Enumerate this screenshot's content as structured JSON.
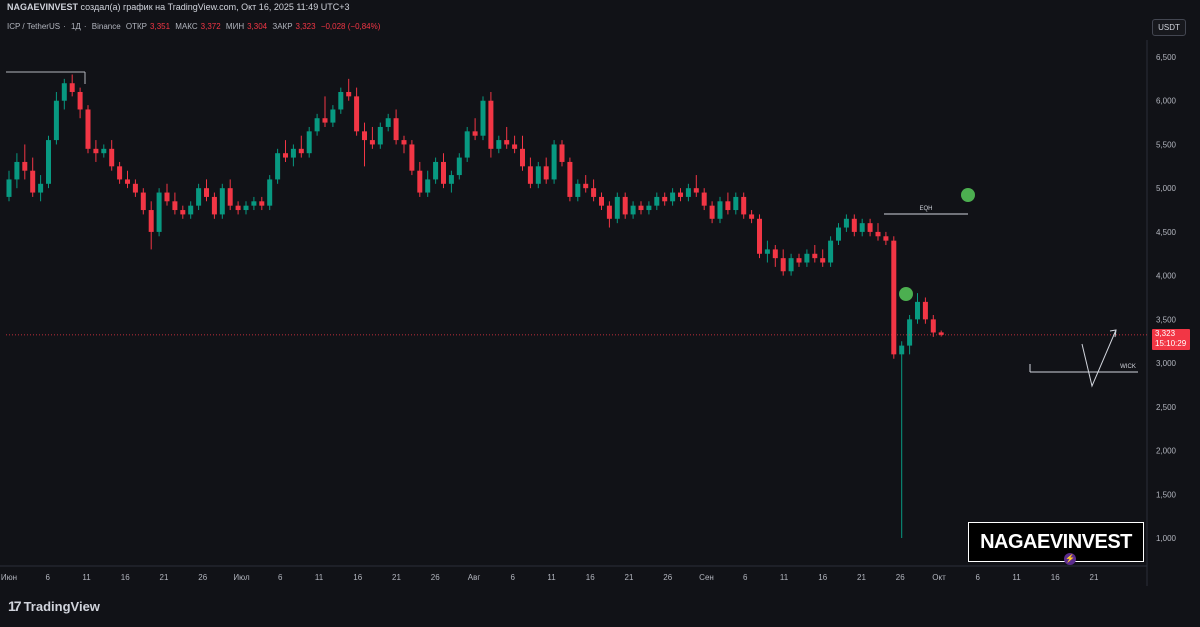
{
  "header": {
    "author": "NAGAEVINVEST",
    "caption": "создал(а) график на TradingView.com, Окт 16, 2025 11:49 UTC+3"
  },
  "symbol": {
    "pair": "ICP / TetherUS",
    "interval": "1Д",
    "exchange": "Binance",
    "open_label": "ОТКР",
    "open": "3,351",
    "high_label": "МАКС",
    "high": "3,372",
    "low_label": "МИН",
    "low": "3,304",
    "close_label": "ЗАКР",
    "close": "3,323",
    "change": "−0,028 (−0,84%)"
  },
  "currency_button": "USDT",
  "price_badge": {
    "price": "3,323",
    "countdown": "15:10:29"
  },
  "annotations": {
    "eqh": "EQH",
    "wick": "WICK"
  },
  "watermark": "NAGAEVINVEST",
  "footer": {
    "brand": "TradingView"
  },
  "colors": {
    "up": "#089981",
    "down": "#f23645",
    "background": "#111217",
    "dot": "#4caf50"
  },
  "chart_data": {
    "type": "candlestick",
    "title": "",
    "y_ticks": [
      1.0,
      1.5,
      2.0,
      2.5,
      3.0,
      3.5,
      4.0,
      4.5,
      5.0,
      5.5,
      6.0,
      6.5
    ],
    "y_tick_labels": [
      "1,000",
      "1,500",
      "2,000",
      "2,500",
      "3,000",
      "3,500",
      "4,000",
      "4,500",
      "5,000",
      "5,500",
      "6,000",
      "6,500"
    ],
    "ylim": [
      0.6,
      6.9
    ],
    "x_tick_labels": [
      "Июн",
      "6",
      "11",
      "16",
      "21",
      "26",
      "Июл",
      "6",
      "11",
      "16",
      "21",
      "26",
      "Авг",
      "6",
      "11",
      "16",
      "21",
      "26",
      "Сен",
      "6",
      "11",
      "16",
      "21",
      "26",
      "Окт",
      "6",
      "11",
      "16",
      "21"
    ],
    "current_price": 3.323,
    "candles": [
      {
        "o": 4.9,
        "h": 5.2,
        "l": 4.85,
        "c": 5.1
      },
      {
        "o": 5.1,
        "h": 5.4,
        "l": 5.0,
        "c": 5.3
      },
      {
        "o": 5.3,
        "h": 5.5,
        "l": 5.1,
        "c": 5.2
      },
      {
        "o": 5.2,
        "h": 5.35,
        "l": 4.9,
        "c": 4.95
      },
      {
        "o": 4.95,
        "h": 5.15,
        "l": 4.85,
        "c": 5.05
      },
      {
        "o": 5.05,
        "h": 5.6,
        "l": 5.0,
        "c": 5.55
      },
      {
        "o": 5.55,
        "h": 6.1,
        "l": 5.5,
        "c": 6.0
      },
      {
        "o": 6.0,
        "h": 6.25,
        "l": 5.9,
        "c": 6.2
      },
      {
        "o": 6.2,
        "h": 6.3,
        "l": 6.05,
        "c": 6.1
      },
      {
        "o": 6.1,
        "h": 6.15,
        "l": 5.8,
        "c": 5.9
      },
      {
        "o": 5.9,
        "h": 5.95,
        "l": 5.4,
        "c": 5.45
      },
      {
        "o": 5.45,
        "h": 5.55,
        "l": 5.3,
        "c": 5.4
      },
      {
        "o": 5.4,
        "h": 5.5,
        "l": 5.35,
        "c": 5.45
      },
      {
        "o": 5.45,
        "h": 5.55,
        "l": 5.2,
        "c": 5.25
      },
      {
        "o": 5.25,
        "h": 5.3,
        "l": 5.05,
        "c": 5.1
      },
      {
        "o": 5.1,
        "h": 5.2,
        "l": 5.0,
        "c": 5.05
      },
      {
        "o": 5.05,
        "h": 5.1,
        "l": 4.9,
        "c": 4.95
      },
      {
        "o": 4.95,
        "h": 5.0,
        "l": 4.7,
        "c": 4.75
      },
      {
        "o": 4.75,
        "h": 4.85,
        "l": 4.3,
        "c": 4.5
      },
      {
        "o": 4.5,
        "h": 5.0,
        "l": 4.45,
        "c": 4.95
      },
      {
        "o": 4.95,
        "h": 5.05,
        "l": 4.8,
        "c": 4.85
      },
      {
        "o": 4.85,
        "h": 4.95,
        "l": 4.7,
        "c": 4.75
      },
      {
        "o": 4.75,
        "h": 4.8,
        "l": 4.65,
        "c": 4.7
      },
      {
        "o": 4.7,
        "h": 4.85,
        "l": 4.65,
        "c": 4.8
      },
      {
        "o": 4.8,
        "h": 5.05,
        "l": 4.75,
        "c": 5.0
      },
      {
        "o": 5.0,
        "h": 5.1,
        "l": 4.85,
        "c": 4.9
      },
      {
        "o": 4.9,
        "h": 4.95,
        "l": 4.65,
        "c": 4.7
      },
      {
        "o": 4.7,
        "h": 5.05,
        "l": 4.65,
        "c": 5.0
      },
      {
        "o": 5.0,
        "h": 5.1,
        "l": 4.75,
        "c": 4.8
      },
      {
        "o": 4.8,
        "h": 4.85,
        "l": 4.7,
        "c": 4.75
      },
      {
        "o": 4.75,
        "h": 4.85,
        "l": 4.7,
        "c": 4.8
      },
      {
        "o": 4.8,
        "h": 4.9,
        "l": 4.75,
        "c": 4.85
      },
      {
        "o": 4.85,
        "h": 4.9,
        "l": 4.75,
        "c": 4.8
      },
      {
        "o": 4.8,
        "h": 5.15,
        "l": 4.75,
        "c": 5.1
      },
      {
        "o": 5.1,
        "h": 5.45,
        "l": 5.05,
        "c": 5.4
      },
      {
        "o": 5.4,
        "h": 5.55,
        "l": 5.3,
        "c": 5.35
      },
      {
        "o": 5.35,
        "h": 5.5,
        "l": 5.25,
        "c": 5.45
      },
      {
        "o": 5.45,
        "h": 5.6,
        "l": 5.35,
        "c": 5.4
      },
      {
        "o": 5.4,
        "h": 5.7,
        "l": 5.35,
        "c": 5.65
      },
      {
        "o": 5.65,
        "h": 5.85,
        "l": 5.6,
        "c": 5.8
      },
      {
        "o": 5.8,
        "h": 6.05,
        "l": 5.7,
        "c": 5.75
      },
      {
        "o": 5.75,
        "h": 5.95,
        "l": 5.7,
        "c": 5.9
      },
      {
        "o": 5.9,
        "h": 6.15,
        "l": 5.85,
        "c": 6.1
      },
      {
        "o": 6.1,
        "h": 6.25,
        "l": 6.0,
        "c": 6.05
      },
      {
        "o": 6.05,
        "h": 6.15,
        "l": 5.6,
        "c": 5.65
      },
      {
        "o": 5.65,
        "h": 5.75,
        "l": 5.25,
        "c": 5.55
      },
      {
        "o": 5.55,
        "h": 5.7,
        "l": 5.45,
        "c": 5.5
      },
      {
        "o": 5.5,
        "h": 5.75,
        "l": 5.45,
        "c": 5.7
      },
      {
        "o": 5.7,
        "h": 5.85,
        "l": 5.65,
        "c": 5.8
      },
      {
        "o": 5.8,
        "h": 5.9,
        "l": 5.5,
        "c": 5.55
      },
      {
        "o": 5.55,
        "h": 5.6,
        "l": 5.4,
        "c": 5.5
      },
      {
        "o": 5.5,
        "h": 5.55,
        "l": 5.15,
        "c": 5.2
      },
      {
        "o": 5.2,
        "h": 5.3,
        "l": 4.9,
        "c": 4.95
      },
      {
        "o": 4.95,
        "h": 5.2,
        "l": 4.9,
        "c": 5.1
      },
      {
        "o": 5.1,
        "h": 5.35,
        "l": 5.05,
        "c": 5.3
      },
      {
        "o": 5.3,
        "h": 5.4,
        "l": 5.0,
        "c": 5.05
      },
      {
        "o": 5.05,
        "h": 5.2,
        "l": 4.95,
        "c": 5.15
      },
      {
        "o": 5.15,
        "h": 5.4,
        "l": 5.1,
        "c": 5.35
      },
      {
        "o": 5.35,
        "h": 5.7,
        "l": 5.3,
        "c": 5.65
      },
      {
        "o": 5.65,
        "h": 5.8,
        "l": 5.55,
        "c": 5.6
      },
      {
        "o": 5.6,
        "h": 6.05,
        "l": 5.55,
        "c": 6.0
      },
      {
        "o": 6.0,
        "h": 6.1,
        "l": 5.35,
        "c": 5.45
      },
      {
        "o": 5.45,
        "h": 5.6,
        "l": 5.4,
        "c": 5.55
      },
      {
        "o": 5.55,
        "h": 5.7,
        "l": 5.45,
        "c": 5.5
      },
      {
        "o": 5.5,
        "h": 5.6,
        "l": 5.4,
        "c": 5.45
      },
      {
        "o": 5.45,
        "h": 5.6,
        "l": 5.2,
        "c": 5.25
      },
      {
        "o": 5.25,
        "h": 5.35,
        "l": 5.0,
        "c": 5.05
      },
      {
        "o": 5.05,
        "h": 5.3,
        "l": 5.0,
        "c": 5.25
      },
      {
        "o": 5.25,
        "h": 5.35,
        "l": 5.05,
        "c": 5.1
      },
      {
        "o": 5.1,
        "h": 5.55,
        "l": 5.05,
        "c": 5.5
      },
      {
        "o": 5.5,
        "h": 5.55,
        "l": 5.25,
        "c": 5.3
      },
      {
        "o": 5.3,
        "h": 5.35,
        "l": 4.85,
        "c": 4.9
      },
      {
        "o": 4.9,
        "h": 5.1,
        "l": 4.85,
        "c": 5.05
      },
      {
        "o": 5.05,
        "h": 5.15,
        "l": 4.95,
        "c": 5.0
      },
      {
        "o": 5.0,
        "h": 5.1,
        "l": 4.85,
        "c": 4.9
      },
      {
        "o": 4.9,
        "h": 4.95,
        "l": 4.75,
        "c": 4.8
      },
      {
        "o": 4.8,
        "h": 4.85,
        "l": 4.55,
        "c": 4.65
      },
      {
        "o": 4.65,
        "h": 4.95,
        "l": 4.6,
        "c": 4.9
      },
      {
        "o": 4.9,
        "h": 4.95,
        "l": 4.65,
        "c": 4.7
      },
      {
        "o": 4.7,
        "h": 4.85,
        "l": 4.65,
        "c": 4.8
      },
      {
        "o": 4.8,
        "h": 4.85,
        "l": 4.7,
        "c": 4.75
      },
      {
        "o": 4.75,
        "h": 4.85,
        "l": 4.7,
        "c": 4.8
      },
      {
        "o": 4.8,
        "h": 4.95,
        "l": 4.75,
        "c": 4.9
      },
      {
        "o": 4.9,
        "h": 4.95,
        "l": 4.8,
        "c": 4.85
      },
      {
        "o": 4.85,
        "h": 5.0,
        "l": 4.8,
        "c": 4.95
      },
      {
        "o": 4.95,
        "h": 5.0,
        "l": 4.85,
        "c": 4.9
      },
      {
        "o": 4.9,
        "h": 5.05,
        "l": 4.85,
        "c": 5.0
      },
      {
        "o": 5.0,
        "h": 5.15,
        "l": 4.9,
        "c": 4.95
      },
      {
        "o": 4.95,
        "h": 5.0,
        "l": 4.75,
        "c": 4.8
      },
      {
        "o": 4.8,
        "h": 4.85,
        "l": 4.6,
        "c": 4.65
      },
      {
        "o": 4.65,
        "h": 4.9,
        "l": 4.6,
        "c": 4.85
      },
      {
        "o": 4.85,
        "h": 4.95,
        "l": 4.7,
        "c": 4.75
      },
      {
        "o": 4.75,
        "h": 4.95,
        "l": 4.7,
        "c": 4.9
      },
      {
        "o": 4.9,
        "h": 4.95,
        "l": 4.65,
        "c": 4.7
      },
      {
        "o": 4.7,
        "h": 4.75,
        "l": 4.6,
        "c": 4.65
      },
      {
        "o": 4.65,
        "h": 4.7,
        "l": 4.2,
        "c": 4.25
      },
      {
        "o": 4.25,
        "h": 4.4,
        "l": 4.15,
        "c": 4.3
      },
      {
        "o": 4.3,
        "h": 4.35,
        "l": 4.1,
        "c": 4.2
      },
      {
        "o": 4.2,
        "h": 4.3,
        "l": 4.0,
        "c": 4.05
      },
      {
        "o": 4.05,
        "h": 4.25,
        "l": 4.0,
        "c": 4.2
      },
      {
        "o": 4.2,
        "h": 4.25,
        "l": 4.1,
        "c": 4.15
      },
      {
        "o": 4.15,
        "h": 4.3,
        "l": 4.1,
        "c": 4.25
      },
      {
        "o": 4.25,
        "h": 4.35,
        "l": 4.15,
        "c": 4.2
      },
      {
        "o": 4.2,
        "h": 4.3,
        "l": 4.1,
        "c": 4.15
      },
      {
        "o": 4.15,
        "h": 4.45,
        "l": 4.1,
        "c": 4.4
      },
      {
        "o": 4.4,
        "h": 4.6,
        "l": 4.35,
        "c": 4.55
      },
      {
        "o": 4.55,
        "h": 4.7,
        "l": 4.5,
        "c": 4.65
      },
      {
        "o": 4.65,
        "h": 4.7,
        "l": 4.45,
        "c": 4.5
      },
      {
        "o": 4.5,
        "h": 4.65,
        "l": 4.45,
        "c": 4.6
      },
      {
        "o": 4.6,
        "h": 4.65,
        "l": 4.45,
        "c": 4.5
      },
      {
        "o": 4.5,
        "h": 4.6,
        "l": 4.4,
        "c": 4.45
      },
      {
        "o": 4.45,
        "h": 4.5,
        "l": 4.35,
        "c": 4.4
      },
      {
        "o": 4.4,
        "h": 4.45,
        "l": 3.05,
        "c": 3.1
      },
      {
        "o": 3.1,
        "h": 3.25,
        "l": 1.0,
        "c": 3.2
      },
      {
        "o": 3.2,
        "h": 3.55,
        "l": 3.1,
        "c": 3.5
      },
      {
        "o": 3.5,
        "h": 3.8,
        "l": 3.45,
        "c": 3.7
      },
      {
        "o": 3.7,
        "h": 3.75,
        "l": 3.45,
        "c": 3.5
      },
      {
        "o": 3.5,
        "h": 3.55,
        "l": 3.3,
        "c": 3.35
      },
      {
        "o": 3.351,
        "h": 3.372,
        "l": 3.304,
        "c": 3.323
      }
    ]
  }
}
